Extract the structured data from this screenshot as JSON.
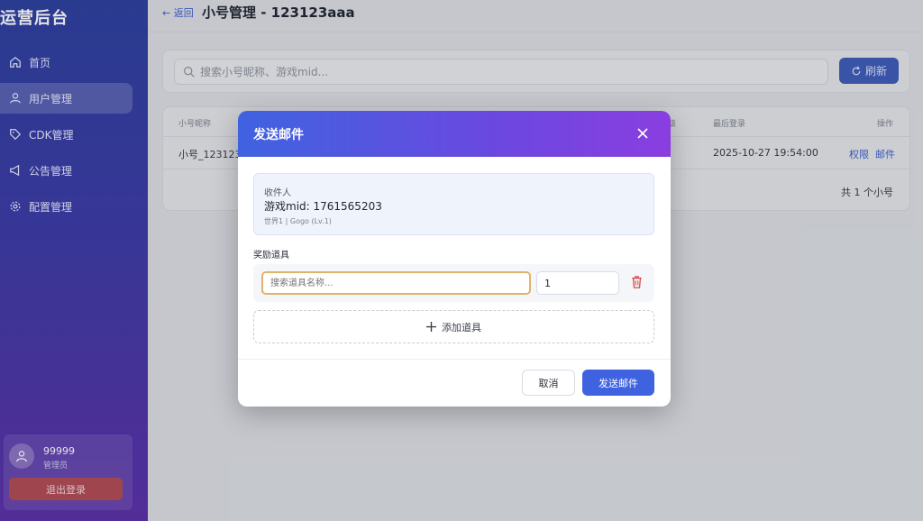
{
  "sidebar": {
    "brand": "运营后台",
    "items": [
      {
        "label": "首页",
        "icon": "home-icon"
      },
      {
        "label": "用户管理",
        "icon": "users-icon"
      },
      {
        "label": "CDK管理",
        "icon": "tag-icon"
      },
      {
        "label": "公告管理",
        "icon": "megaphone-icon"
      },
      {
        "label": "配置管理",
        "icon": "gear-icon"
      }
    ],
    "active_index": 1,
    "user": {
      "name": "99999",
      "role": "管理员"
    },
    "logout_label": "退出登录"
  },
  "header": {
    "back_label": "← 返回",
    "title": "小号管理 - 123123aaa"
  },
  "search": {
    "placeholder": "搜索小号昵称、游戏mid...",
    "refresh_label": "刷新"
  },
  "table": {
    "headers": {
      "nickname": "小号昵称",
      "level": "级",
      "last_login": "最后登录",
      "actions": "操作"
    },
    "rows": [
      {
        "nickname": "小号_123123a",
        "last_login": "2025-10-27 19:54:00",
        "action_permissions": "权限",
        "action_mail": "邮件"
      }
    ],
    "total": "共 1 个小号"
  },
  "modal": {
    "title": "发送邮件",
    "recipient_label": "收件人",
    "recipient_mid": "游戏mid: 1761565203",
    "recipient_sub": "世界1 | Gogo (Lv.1)",
    "items_label": "奖励道具",
    "item_placeholder": "搜索道具名称...",
    "item_qty": "1",
    "add_item_label": "添加道具",
    "cancel_label": "取消",
    "send_label": "发送邮件"
  },
  "colors": {
    "accent": "#3f63e0",
    "danger": "#d64545",
    "focus_border": "#e0b36a"
  }
}
